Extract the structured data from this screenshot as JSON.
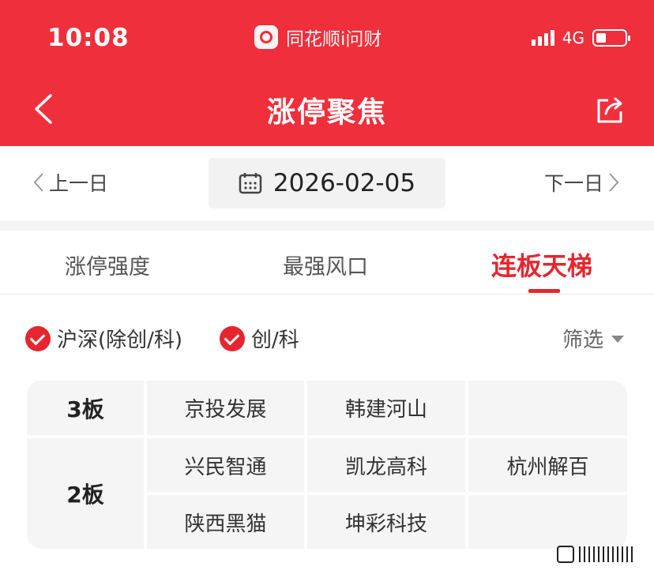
{
  "status_bar": {
    "time": "10:08",
    "app_name": "同花顺i问财",
    "network": "4G"
  },
  "header": {
    "title": "涨停聚焦"
  },
  "date_nav": {
    "prev_label": "上一日",
    "date": "2026-02-05",
    "next_label": "下一日"
  },
  "tabs": [
    {
      "label": "涨停强度"
    },
    {
      "label": "最强风口"
    },
    {
      "label": "连板天梯",
      "active": true
    }
  ],
  "filters": {
    "option1": "沪深(除创/科)",
    "option2": "创/科",
    "filter_label": "筛选"
  },
  "ladder": {
    "tiers": [
      {
        "label": "3板",
        "stocks": [
          "京投发展",
          "韩建河山"
        ]
      },
      {
        "label": "2板",
        "stocks": [
          "兴民智通",
          "凯龙高科",
          "杭州解百",
          "陕西黑猫",
          "坤彩科技"
        ]
      }
    ]
  },
  "colors": {
    "brand_red": "#ef2f3b",
    "accent_red": "#e5262f",
    "cell_bg": "#f5f5f5"
  }
}
